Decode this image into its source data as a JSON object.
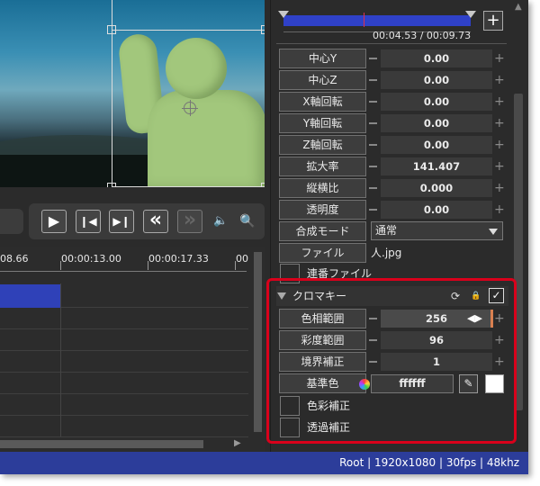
{
  "colors": {
    "accent_blue": "#2f41c8",
    "status_bar": "#2c3d9a",
    "highlight_frame": "#d9001b",
    "panel_bg": "#2b2b2b",
    "key_color_swatch": "#ffffff"
  },
  "transport": {
    "play": "▶",
    "prev_frame": "❙◀",
    "next_frame": "▶❙",
    "rewind": "«",
    "fast_forward": "»",
    "volume_icon": "🔈",
    "zoom_icon": "🔍"
  },
  "timeline": {
    "ruler_labels": [
      "08.66",
      "00:00:13.00",
      "00:00:17.33",
      "00"
    ]
  },
  "seekbar": {
    "add_button": "+",
    "time_text": "00:04.53 / 00:09.73",
    "position_fraction": 0.4655
  },
  "properties": [
    {
      "label": "中心Y",
      "value": "0.00"
    },
    {
      "label": "中心Z",
      "value": "0.00"
    },
    {
      "label": "X軸回転",
      "value": "0.00"
    },
    {
      "label": "Y軸回転",
      "value": "0.00"
    },
    {
      "label": "Z軸回転",
      "value": "0.00"
    },
    {
      "label": "拡大率",
      "value": "141.407"
    },
    {
      "label": "縦横比",
      "value": "0.000"
    },
    {
      "label": "透明度",
      "value": "0.00"
    }
  ],
  "blend": {
    "label": "合成モード",
    "value": "通常"
  },
  "file": {
    "label": "ファイル",
    "value": "人.jpg"
  },
  "sequential": {
    "label": "連番ファイル"
  },
  "chromakey": {
    "title": "クロマキー",
    "refresh_icon": "⟳",
    "lock_icon": "🔒",
    "enabled_mark": "✓",
    "hue_range": {
      "label": "色相範囲",
      "value": "256"
    },
    "saturation_range": {
      "label": "彩度範囲",
      "value": "96"
    },
    "edge_correction": {
      "label": "境界補正",
      "value": "1"
    },
    "key_color": {
      "label": "基準色",
      "hex": "ffffff",
      "picker_icon": "✎"
    },
    "color_correction": {
      "label": "色彩補正"
    },
    "transparency_correction": {
      "label": "透過補正"
    }
  },
  "statusbar": {
    "text": "Root  |  1920x1080  |  30fps  |  48khz"
  }
}
